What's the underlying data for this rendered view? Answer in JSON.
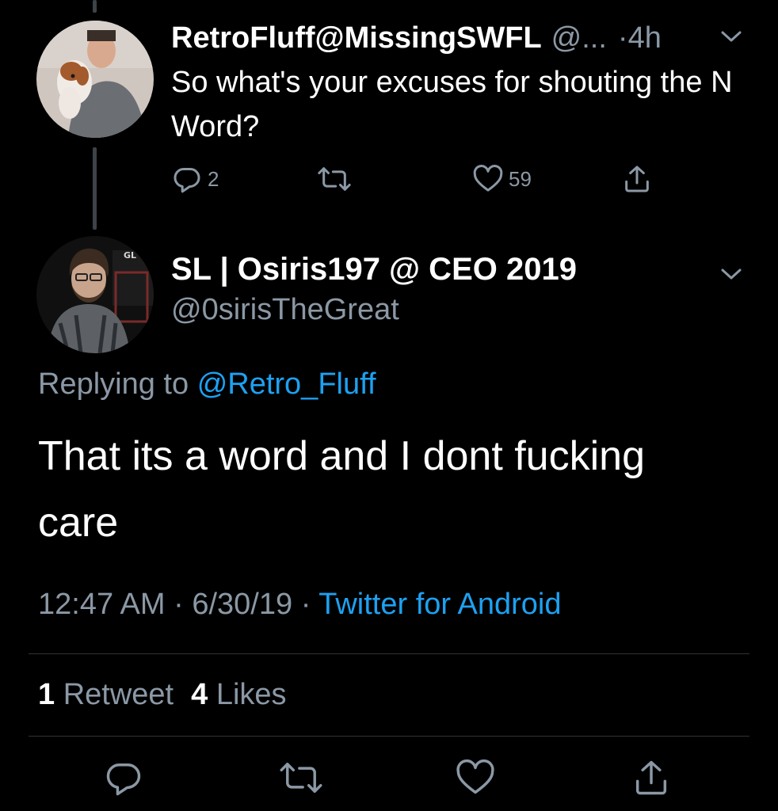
{
  "parent_tweet": {
    "name": "RetroFluff@MissingSWFL",
    "handle": "@...",
    "time": "·4h",
    "text": "So what's your excuses for shouting the N Word?",
    "actions": {
      "reply_count": "2",
      "retweet_count": "",
      "like_count": "59"
    }
  },
  "reply_tweet": {
    "name": "SL | Osiris197 @ CEO 2019",
    "handle": "@0sirisTheGreat",
    "replying_prefix": "Replying to",
    "replying_mention": "@Retro_Fluff",
    "text": "That its a word and I dont fucking care",
    "time": "12:47 AM",
    "date": "6/30/19",
    "source": "Twitter for Android",
    "separator": "·",
    "stats": {
      "retweets_count": "1",
      "retweets_label": "Retweet",
      "likes_count": "4",
      "likes_label": "Likes"
    },
    "avatar_badge": "GL"
  },
  "colors": {
    "background": "#000000",
    "text_primary": "#ffffff",
    "text_secondary": "#8b98a5",
    "accent": "#1da1f2",
    "divider": "#2f3336",
    "thread_line": "#3d4349"
  },
  "icons": {
    "reply": "reply-icon",
    "retweet": "retweet-icon",
    "like": "heart-icon",
    "share": "share-icon",
    "menu": "chevron-down-icon"
  }
}
